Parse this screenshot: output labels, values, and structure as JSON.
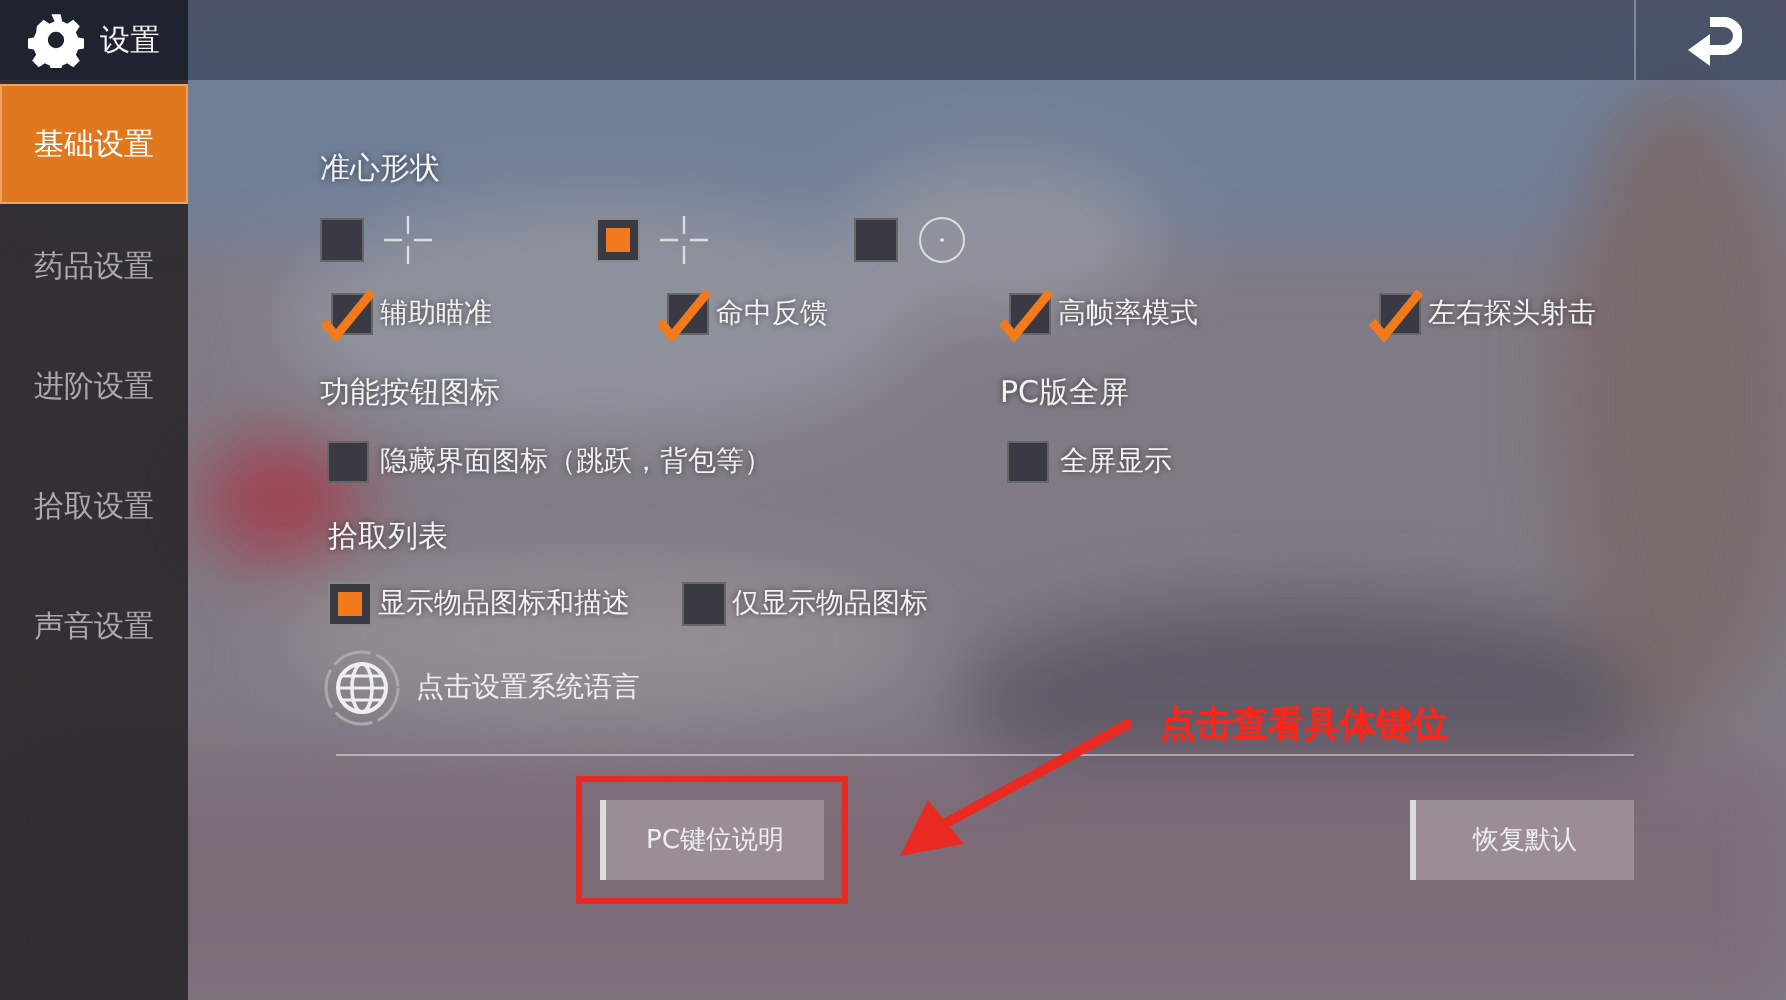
{
  "header": {
    "title": "设置"
  },
  "sidebar": {
    "items": [
      {
        "label": "基础设置",
        "selected": true
      },
      {
        "label": "药品设置",
        "selected": false
      },
      {
        "label": "进阶设置",
        "selected": false
      },
      {
        "label": "拾取设置",
        "selected": false
      },
      {
        "label": "声音设置",
        "selected": false
      }
    ]
  },
  "crosshair": {
    "title": "准心形状",
    "options": [
      {
        "kind": "cross",
        "selected": false
      },
      {
        "kind": "cross",
        "selected": true
      },
      {
        "kind": "circle",
        "selected": false
      }
    ]
  },
  "toggles": [
    {
      "label": "辅助瞄准",
      "checked": true
    },
    {
      "label": "命中反馈",
      "checked": true
    },
    {
      "label": "高帧率模式",
      "checked": true
    },
    {
      "label": "左右探头射击",
      "checked": true
    }
  ],
  "sections": [
    {
      "title": "功能按钮图标",
      "options": [
        {
          "label": "隐藏界面图标（跳跃，背包等）",
          "checked": false
        }
      ]
    },
    {
      "title": "PC版全屏",
      "options": [
        {
          "label": "全屏显示",
          "checked": false
        }
      ]
    }
  ],
  "pickup_list": {
    "title": "拾取列表",
    "options": [
      {
        "label": "显示物品图标和描述",
        "selected": true
      },
      {
        "label": "仅显示物品图标",
        "selected": false
      }
    ]
  },
  "language_link": "点击设置系统语言",
  "buttons": [
    {
      "label": "PC键位说明",
      "highlighted": true
    },
    {
      "label": "恢复默认",
      "highlighted": false
    }
  ],
  "annotation": {
    "text": "点击查看具体键位"
  }
}
